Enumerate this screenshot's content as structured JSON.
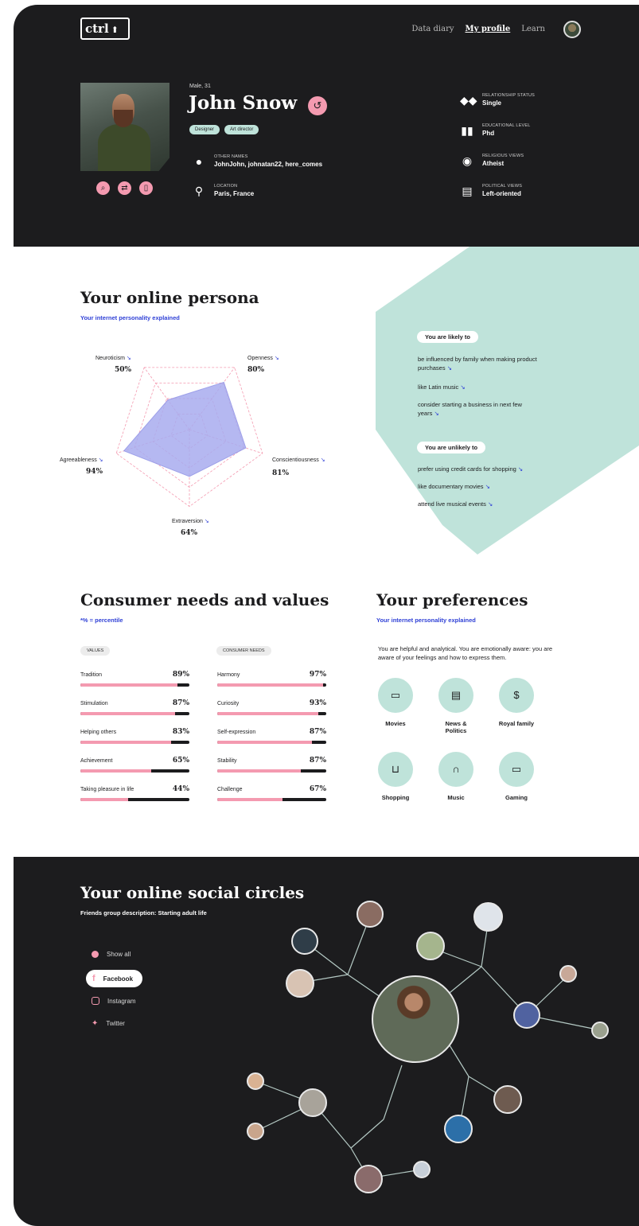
{
  "nav": {
    "logo": "ctrl",
    "items": [
      "Data diary",
      "My profile",
      "Learn"
    ],
    "active": "My profile"
  },
  "profile": {
    "meta": "Male, 31",
    "name": "John Snow",
    "tags": [
      "Designer",
      "Art director"
    ],
    "other_names_label": "OTHER NAMES",
    "other_names": "JohnJohn, johnatan22, here_comes",
    "location_label": "LOCATION",
    "location": "Paris, France",
    "relationship_label": "RELATIONSHIP STATUS",
    "relationship": "Single",
    "education_label": "EDUCATIONAL LEVEL",
    "education": "Phd",
    "religious_label": "RELIGIOUS VIEWS",
    "religious": "Atheist",
    "political_label": "POLITICAL VIEWS",
    "political": "Left-oriented"
  },
  "persona": {
    "title": "Your online persona",
    "subtitle": "Your internet personality explained",
    "traits": [
      {
        "name": "Neuroticism",
        "value": "50%",
        "score": 50
      },
      {
        "name": "Openness",
        "value": "80%",
        "score": 80
      },
      {
        "name": "Conscientiousness",
        "value": "81%",
        "score": 81
      },
      {
        "name": "Extraversion",
        "value": "64%",
        "score": 64
      },
      {
        "name": "Agreeableness",
        "value": "94%",
        "score": 94
      }
    ],
    "likely_label": "You are likely to",
    "likely": [
      "be influenced by family when making product purchases",
      "like Latin music",
      "consider starting a business in next few years"
    ],
    "unlikely_label": "You are unlikely to",
    "unlikely": [
      "prefer using credit cards for shopping",
      "like documentary movies",
      "attend live musical events"
    ]
  },
  "needs": {
    "title": "Consumer needs and values",
    "subtitle": "*% = percentile",
    "values_label": "VALUES",
    "needs_label": "CONSUMER NEEDS",
    "values": [
      {
        "name": "Tradition",
        "pct": "89%",
        "score": 89
      },
      {
        "name": "Stimulation",
        "pct": "87%",
        "score": 87
      },
      {
        "name": "Helping others",
        "pct": "83%",
        "score": 83
      },
      {
        "name": "Achievement",
        "pct": "65%",
        "score": 65
      },
      {
        "name": "Taking pleasure in life",
        "pct": "44%",
        "score": 44
      }
    ],
    "needs": [
      {
        "name": "Harmony",
        "pct": "97%",
        "score": 97
      },
      {
        "name": "Curiosity",
        "pct": "93%",
        "score": 93
      },
      {
        "name": "Self-expression",
        "pct": "87%",
        "score": 87
      },
      {
        "name": "Stability",
        "pct": "87%",
        "score": 77
      },
      {
        "name": "Challenge",
        "pct": "67%",
        "score": 60
      }
    ]
  },
  "preferences": {
    "title": "Your preferences",
    "subtitle": "Your internet personality explained",
    "text": "You are helpful and analytical. You are emotionally aware: you are aware of your feelings and how to express them.",
    "items": [
      {
        "label": "Movies",
        "icon": "video-icon"
      },
      {
        "label": "News & Politics",
        "icon": "news-icon"
      },
      {
        "label": "Royal family",
        "icon": "dollar-icon"
      },
      {
        "label": "Shopping",
        "icon": "cart-icon"
      },
      {
        "label": "Music",
        "icon": "headphones-icon"
      },
      {
        "label": "Gaming",
        "icon": "video-icon"
      }
    ]
  },
  "social": {
    "title": "Your online social circles",
    "subtitle": "Friends group description: Starting adult life",
    "filters": [
      "Show all",
      "Facebook",
      "Instagram",
      "Twitter"
    ],
    "selected": "Facebook"
  },
  "colors": {
    "dark": "#1c1c1e",
    "pink": "#f49ab0",
    "mint": "#bfe3da",
    "blue": "#2f40d6",
    "radar": "#a9acef"
  }
}
